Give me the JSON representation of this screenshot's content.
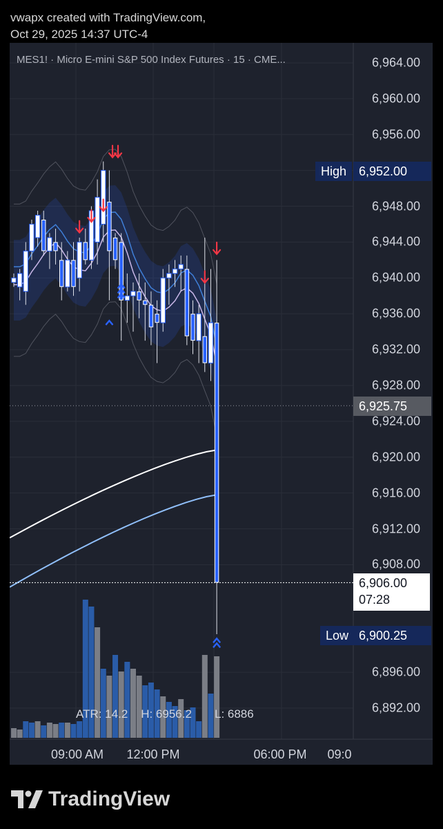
{
  "header": {
    "line1": "vwapx created with TradingView.com,",
    "line2": "Oct 29, 2025 14:37 UTC-4"
  },
  "symbol_line": "MES1! · Micro E-mini S&P 500 Index Futures · 15 · CME...",
  "stats": {
    "atr": "ATR: 14.2",
    "high": "H: 6956.2",
    "low": "L: 6886"
  },
  "markers": {
    "high_label": "High",
    "high_value": "6,952.00",
    "low_label": "Low",
    "low_value": "6,900.25",
    "last_value": "6,925.75",
    "current_value": "6,906.00",
    "countdown": "07:28"
  },
  "brand": "TradingView",
  "colors": {
    "background": "#000000",
    "panel": "#1e222d",
    "up_candle": "#ffffff",
    "down_candle": "#2962ff",
    "volume_up": "#2a5ca8",
    "volume_down": "#7b7e86",
    "sell_arrow": "#f23645",
    "buy_arrow": "#2962ff",
    "badge_blue": "#15285a"
  },
  "chart_data": {
    "type": "candlestick",
    "y_ticks": [
      "6,964.00",
      "6,960.00",
      "6,956.00",
      "6,952.00",
      "6,948.00",
      "6,944.00",
      "6,940.00",
      "6,936.00",
      "6,932.00",
      "6,928.00",
      "6,924.00",
      "6,920.00",
      "6,916.00",
      "6,912.00",
      "6,908.00",
      "6,896.00",
      "6,892.00"
    ],
    "y_tick_values": [
      6964,
      6960,
      6956,
      6952,
      6948,
      6944,
      6940,
      6936,
      6932,
      6928,
      6924,
      6920,
      6916,
      6912,
      6908,
      6896,
      6892
    ],
    "ylim": [
      6888,
      6967
    ],
    "x_ticks": [
      "09:00 AM",
      "12:00 PM",
      "06:00 PM",
      "09:0"
    ],
    "candles": [
      {
        "o": 6939.5,
        "h": 6940.5,
        "l": 6939.0,
        "c": 6940.0
      },
      {
        "o": 6939.0,
        "h": 6941.0,
        "l": 6937.5,
        "c": 6940.5
      },
      {
        "o": 6938.5,
        "h": 6944.0,
        "l": 6937.0,
        "c": 6943.0
      },
      {
        "o": 6943.0,
        "h": 6946.5,
        "l": 6942.0,
        "c": 6946.0
      },
      {
        "o": 6944.5,
        "h": 6947.5,
        "l": 6943.5,
        "c": 6947.0
      },
      {
        "o": 6946.5,
        "h": 6947.5,
        "l": 6942.5,
        "c": 6943.0
      },
      {
        "o": 6943.0,
        "h": 6945.0,
        "l": 6941.0,
        "c": 6944.5
      },
      {
        "o": 6944.0,
        "h": 6945.5,
        "l": 6941.5,
        "c": 6943.0
      },
      {
        "o": 6942.0,
        "h": 6944.0,
        "l": 6937.5,
        "c": 6939.0
      },
      {
        "o": 6939.0,
        "h": 6943.0,
        "l": 6938.5,
        "c": 6942.0
      },
      {
        "o": 6942.0,
        "h": 6944.0,
        "l": 6938.0,
        "c": 6939.0
      },
      {
        "o": 6940.0,
        "h": 6944.5,
        "l": 6938.5,
        "c": 6944.0
      },
      {
        "o": 6944.0,
        "h": 6945.5,
        "l": 6941.5,
        "c": 6942.0
      },
      {
        "o": 6942.0,
        "h": 6948.0,
        "l": 6941.0,
        "c": 6947.5
      },
      {
        "o": 6944.0,
        "h": 6951.0,
        "l": 6941.5,
        "c": 6949.0
      },
      {
        "o": 6946.0,
        "h": 6953.0,
        "l": 6944.0,
        "c": 6952.0
      },
      {
        "o": 6948.5,
        "h": 6952.0,
        "l": 6937.5,
        "c": 6943.0
      },
      {
        "o": 6944.5,
        "h": 6945.0,
        "l": 6941.0,
        "c": 6942.0
      },
      {
        "o": 6944.0,
        "h": 6945.0,
        "l": 6933.0,
        "c": 6937.5
      },
      {
        "o": 6937.5,
        "h": 6940.5,
        "l": 6935.0,
        "c": 6938.0
      },
      {
        "o": 6938.0,
        "h": 6939.5,
        "l": 6934.0,
        "c": 6938.5
      },
      {
        "o": 6938.5,
        "h": 6940.5,
        "l": 6935.5,
        "c": 6937.5
      },
      {
        "o": 6937.5,
        "h": 6939.5,
        "l": 6933.0,
        "c": 6937.0
      },
      {
        "o": 6937.0,
        "h": 6938.5,
        "l": 6932.5,
        "c": 6934.5
      },
      {
        "o": 6936.0,
        "h": 6937.5,
        "l": 6930.5,
        "c": 6935.0
      },
      {
        "o": 6935.0,
        "h": 6941.0,
        "l": 6934.0,
        "c": 6940.0
      },
      {
        "o": 6940.0,
        "h": 6941.5,
        "l": 6937.0,
        "c": 6940.5
      },
      {
        "o": 6940.5,
        "h": 6942.0,
        "l": 6939.0,
        "c": 6941.0
      },
      {
        "o": 6941.0,
        "h": 6942.5,
        "l": 6938.5,
        "c": 6941.5
      },
      {
        "o": 6941.0,
        "h": 6942.5,
        "l": 6932.5,
        "c": 6933.5
      },
      {
        "o": 6936.0,
        "h": 6937.5,
        "l": 6931.5,
        "c": 6933.0
      },
      {
        "o": 6933.0,
        "h": 6937.0,
        "l": 6930.5,
        "c": 6936.0
      },
      {
        "o": 6933.5,
        "h": 6944.5,
        "l": 6929.5,
        "c": 6930.5
      },
      {
        "o": 6930.5,
        "h": 6941.0,
        "l": 6928.5,
        "c": 6935.0
      },
      {
        "o": 6935.0,
        "h": 6942.0,
        "l": 6900.25,
        "c": 6906.0
      }
    ],
    "volume": [
      {
        "v": 7,
        "up": false
      },
      {
        "v": 6,
        "up": false
      },
      {
        "v": 12,
        "up": true
      },
      {
        "v": 11,
        "up": true
      },
      {
        "v": 12,
        "up": false
      },
      {
        "v": 9,
        "up": true
      },
      {
        "v": 11,
        "up": false
      },
      {
        "v": 10,
        "up": false
      },
      {
        "v": 11,
        "up": true
      },
      {
        "v": 11,
        "up": false
      },
      {
        "v": 10,
        "up": true
      },
      {
        "v": 12,
        "up": true
      },
      {
        "v": 100,
        "up": true
      },
      {
        "v": 95,
        "up": true
      },
      {
        "v": 80,
        "up": false
      },
      {
        "v": 50,
        "up": true
      },
      {
        "v": 45,
        "up": false
      },
      {
        "v": 60,
        "up": true
      },
      {
        "v": 48,
        "up": false
      },
      {
        "v": 55,
        "up": true
      },
      {
        "v": 50,
        "up": false
      },
      {
        "v": 45,
        "up": false
      },
      {
        "v": 38,
        "up": true
      },
      {
        "v": 40,
        "up": true
      },
      {
        "v": 35,
        "up": true
      },
      {
        "v": 30,
        "up": false
      },
      {
        "v": 26,
        "up": true
      },
      {
        "v": 23,
        "up": true
      },
      {
        "v": 28,
        "up": false
      },
      {
        "v": 20,
        "up": true
      },
      {
        "v": 22,
        "up": true
      },
      {
        "v": 12,
        "up": true
      },
      {
        "v": 60,
        "up": false
      },
      {
        "v": 32,
        "up": true
      },
      {
        "v": 59,
        "up": false
      }
    ],
    "sell_signals": [
      {
        "i": 11,
        "price": 6945.6,
        "count": 1
      },
      {
        "i": 13,
        "price": 6946.8,
        "count": 1
      },
      {
        "i": 15,
        "price": 6948.0,
        "count": 1
      },
      {
        "i": 17,
        "price": 6954.0,
        "count": 2
      },
      {
        "i": 32,
        "price": 6940.0,
        "count": 1
      },
      {
        "i": 34,
        "price": 6943.2,
        "count": 1
      }
    ],
    "buy_signals": [
      {
        "i": 16,
        "price": 6935.0,
        "count": 1
      },
      {
        "i": 18,
        "price": 6938.0,
        "count": 3
      },
      {
        "i": 34,
        "price": 6899.0,
        "count": 2
      }
    ],
    "ema_white": {
      "p0": 6911.0,
      "p1": 6920.8
    },
    "ema_blue": {
      "p0": 6905.5,
      "p1": 6915.8
    }
  }
}
